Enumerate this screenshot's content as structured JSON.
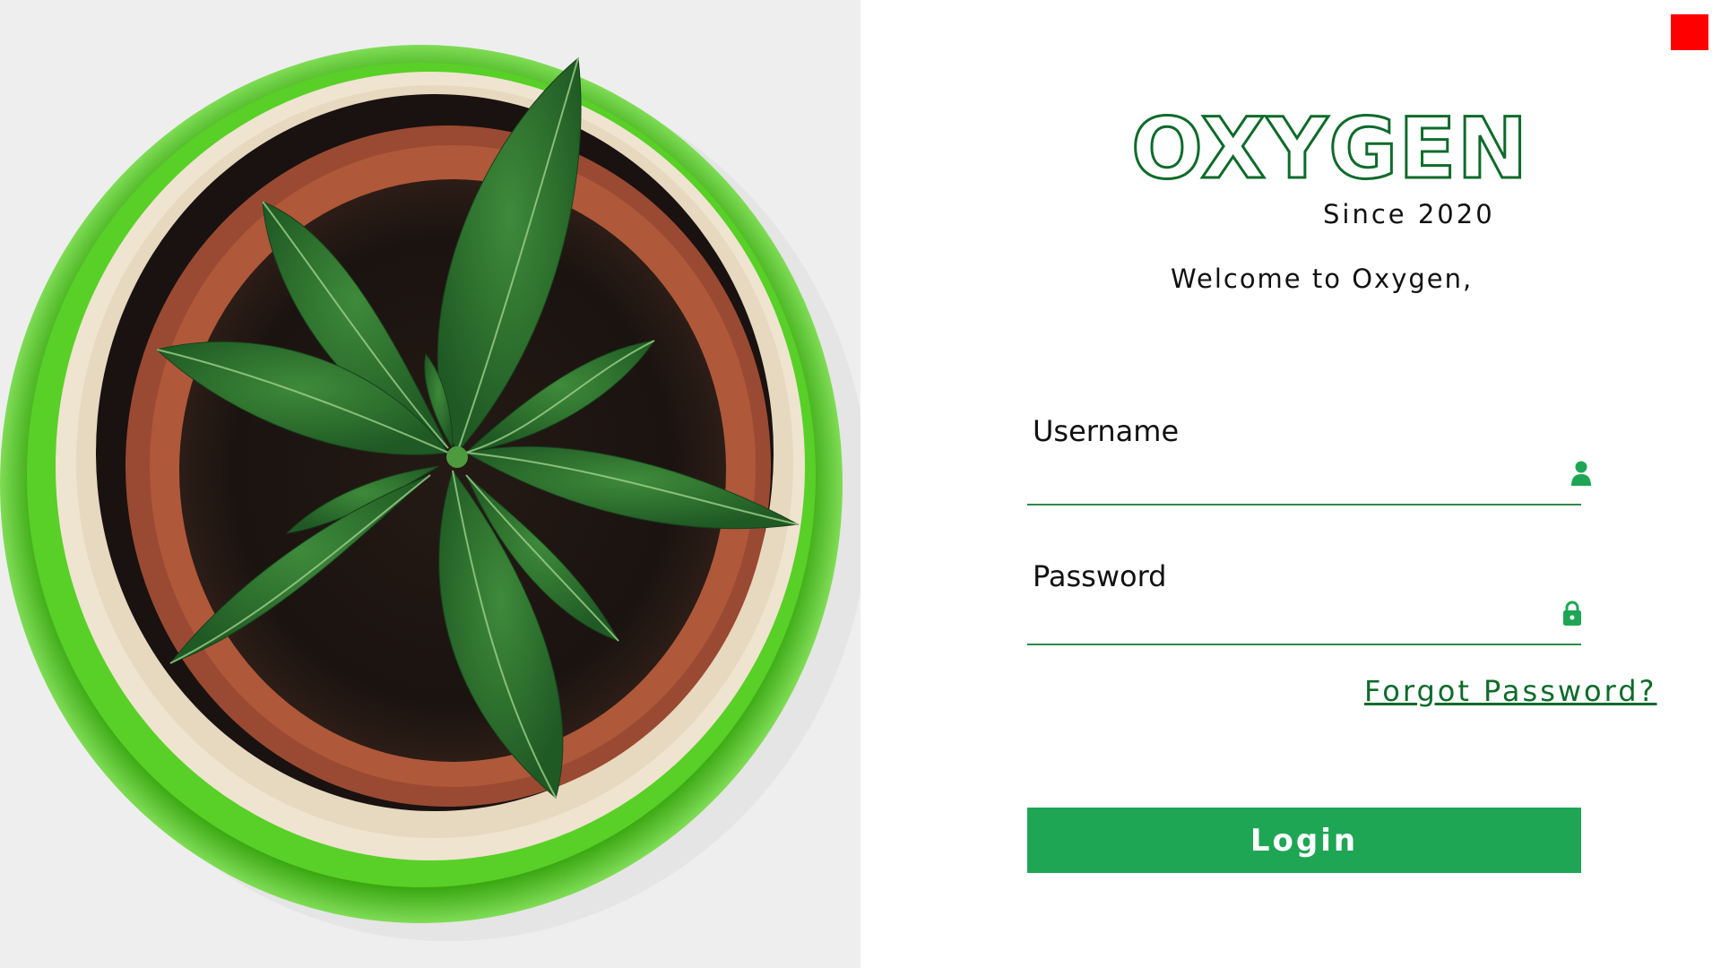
{
  "brand": {
    "name": "OXYGEN",
    "since": "Since 2020",
    "welcome": "Welcome to Oxygen,"
  },
  "form": {
    "username_label": "Username",
    "username_value": "",
    "password_label": "Password",
    "password_value": "",
    "forgot_label": "Forgot Password?",
    "login_label": "Login"
  },
  "icons": {
    "username": "user-icon",
    "password": "lock-icon",
    "close": "close-square-icon"
  },
  "colors": {
    "brand_green": "#0e6b2b",
    "button_green": "#1fa655",
    "close_red": "#ff0000"
  }
}
